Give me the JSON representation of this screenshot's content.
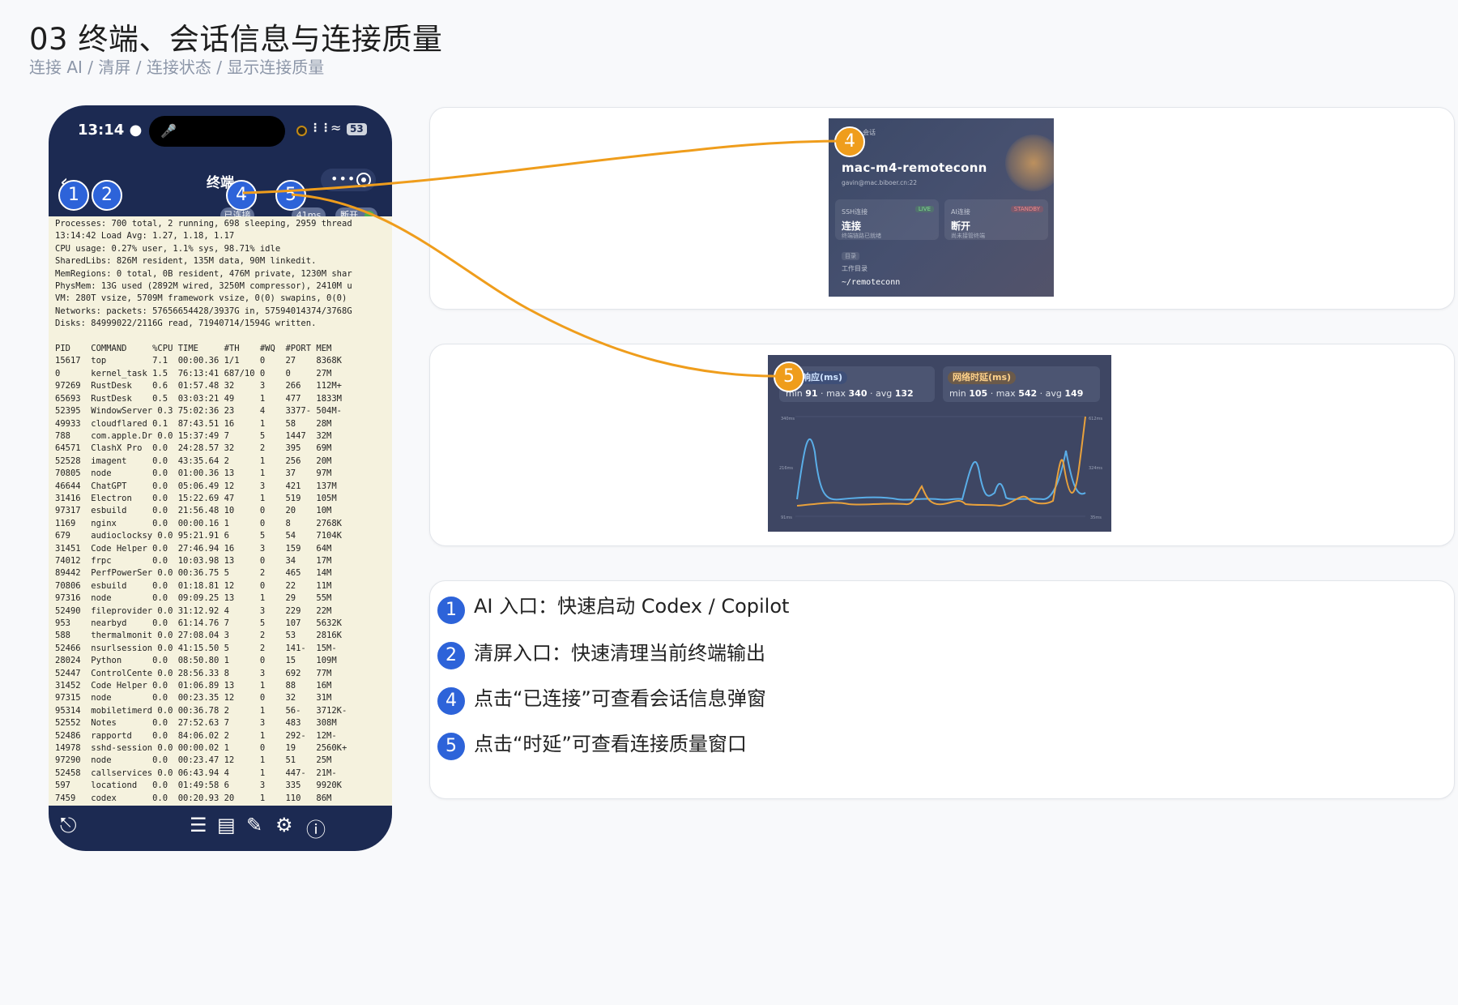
{
  "header": {
    "title": "03 终端、会话信息与连接质量",
    "subtitle": "连接 AI / 清屏 / 连接状态 / 显示连接质量"
  },
  "phone": {
    "status": {
      "time": "13:14",
      "battery": "53"
    },
    "nav": {
      "title": "终端"
    },
    "chips": {
      "connected": "已连接",
      "latency": "41ms",
      "disconnect": "断开"
    },
    "terminal_text": "Processes: 700 total, 2 running, 698 sleeping, 2959 thread\n13:14:42 Load Avg: 1.27, 1.18, 1.17\nCPU usage: 0.27% user, 1.1% sys, 98.71% idle\nSharedLibs: 826M resident, 135M data, 90M linkedit.\nMemRegions: 0 total, 0B resident, 476M private, 1230M shar\nPhysMem: 13G used (2892M wired, 3250M compressor), 2410M u\nVM: 280T vsize, 5709M framework vsize, 0(0) swapins, 0(0)\nNetworks: packets: 57656654428/3937G in, 57594014374/3768G\nDisks: 84999022/2116G read, 71940714/1594G written.\n\nPID    COMMAND     %CPU TIME     #TH    #WQ  #PORT MEM\n15617  top         7.1  00:00.36 1/1    0    27    8368K\n0      kernel_task 1.5  76:13:41 687/10 0    0     27M\n97269  RustDesk    0.6  01:57.48 32     3    266   112M+\n65693  RustDesk    0.5  03:03:21 49     1    477   1833M\n52395  WindowServer 0.3 75:02:36 23     4    3377- 504M-\n49933  cloudflared 0.1  87:43.51 16     1    58    28M\n788    com.apple.Dr 0.0 15:37:49 7      5    1447  32M\n64571  ClashX Pro  0.0  24:28.57 32     2    395   69M\n52528  imagent     0.0  43:35.64 2      1    256   20M\n70805  node        0.0  01:00.36 13     1    37    97M\n46644  ChatGPT     0.0  05:06.49 12     3    421   137M\n31416  Electron    0.0  15:22.69 47     1    519   105M\n97317  esbuild     0.0  21:56.48 10     0    20    10M\n1169   nginx       0.0  00:00.16 1      0    8     2768K\n679    audioclocksy 0.0 95:21.91 6      5    54    7104K\n31451  Code Helper 0.0  27:46.94 16     3    159   64M\n74012  frpc        0.0  10:03.98 13     0    34    17M\n89442  PerfPowerSer 0.0 00:36.75 5      2    465   14M\n70806  esbuild     0.0  01:18.81 12     0    22    11M\n97316  node        0.0  09:09.25 13     1    29    55M\n52490  fileprovider 0.0 31:12.92 4      3    229   22M\n953    nearbyd     0.0  61:14.76 7      5    107   5632K\n588    thermalmonit 0.0 27:08.04 3      2    53    2816K\n52466  nsurlsession 0.0 41:15.50 5      2    141-  15M-\n28024  Python      0.0  08:50.80 1      0    15    109M\n52447  ControlCente 0.0 28:56.33 8      3    692   77M\n31452  Code Helper 0.0  01:06.89 13     1    88    16M\n97315  node        0.0  00:23.35 12     0    32    31M\n95314  mobiletimerd 0.0 00:36.78 2      1    56-   3712K-\n52552  Notes       0.0  27:52.63 7      3    483   308M\n52486  rapportd    0.0  84:06.02 2      1    292-  12M-\n14978  sshd-session 0.0 00:00.02 1      0    19    2560K+\n97290  node        0.0  00:23.47 12     1    51    25M\n52458  callservices 0.0 06:43.94 4      1    447-  21M-\n597    locationd   0.0  01:49:58 6      3    335   9920K\n7459   codex       0.0  00:20.93 20     1    110   86M"
  },
  "badges": {
    "b1": "1",
    "b2": "2",
    "b4": "4",
    "b5": "5"
  },
  "session_popup": {
    "section": "会话",
    "host": "mac-m4-remoteconn",
    "address": "gavin@mac.biboer.cn:22",
    "ssh": {
      "label": "SSH连接",
      "tag": "LIVE",
      "value": "连接",
      "sub": "终端链路已就绪"
    },
    "ai": {
      "label": "AI连接",
      "tag": "STANDBY",
      "value": "断开",
      "sub": "尚未接管终端"
    },
    "dir_tag": "目录",
    "dir_label": "工作目录",
    "dir_value": "~/remoteconn"
  },
  "quality_popup": {
    "response": {
      "title": "响应(ms)",
      "min_label": "min",
      "min": "91",
      "max_label": "max",
      "max": "340",
      "avg_label": "avg",
      "avg": "132"
    },
    "latency": {
      "title": "网络时延(ms)",
      "min_label": "min",
      "min": "105",
      "max_label": "max",
      "max": "542",
      "avg_label": "avg",
      "avg": "149"
    },
    "axis_left": {
      "top": "340ms",
      "mid": "216ms",
      "bottom": "91ms"
    },
    "axis_right": {
      "top": "612ms",
      "mid": "324ms",
      "bottom": "35ms"
    },
    "colors": {
      "response": "#5aaee8",
      "latency": "#e8a13c"
    }
  },
  "legend": [
    {
      "num": "1",
      "text": "AI 入口：快速启动 Codex / Copilot"
    },
    {
      "num": "2",
      "text": "清屏入口：快速清理当前终端输出"
    },
    {
      "num": "4",
      "text": "点击“已连接”可查看会话信息弹窗"
    },
    {
      "num": "5",
      "text": "点击“时延”可查看连接质量窗口"
    }
  ],
  "colors": {
    "badge_blue": "#2d63d9",
    "badge_orange": "#ef9d1c",
    "connector": "#ef9d1c",
    "phone_bg": "#1c2a52",
    "terminal_bg": "#f5f2de"
  }
}
